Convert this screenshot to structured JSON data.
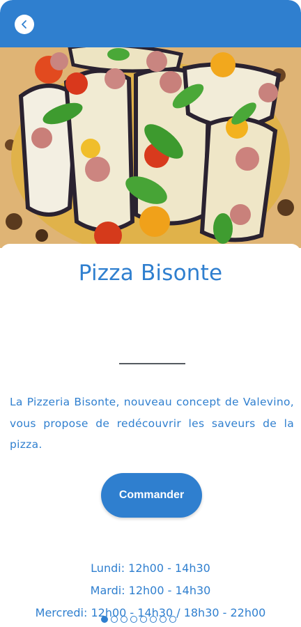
{
  "header": {
    "back_icon": "chevron-left-icon",
    "accent_color": "#2f7fcf"
  },
  "hero": {
    "image": "pizza-photo"
  },
  "main": {
    "title": "Pizza Bisonte",
    "description": "La Pizzeria Bisonte, nouveau concept de Valevino, vous propose de redécouvrir les saveurs de la pizza.",
    "order_button_label": "Commander"
  },
  "hours": [
    "Lundi: 12h00 - 14h30",
    "Mardi: 12h00 - 14h30",
    "Mercredi: 12h00 - 14h30 / 18h30 - 22h00"
  ],
  "pager": {
    "count": 8,
    "active_index": 0
  }
}
